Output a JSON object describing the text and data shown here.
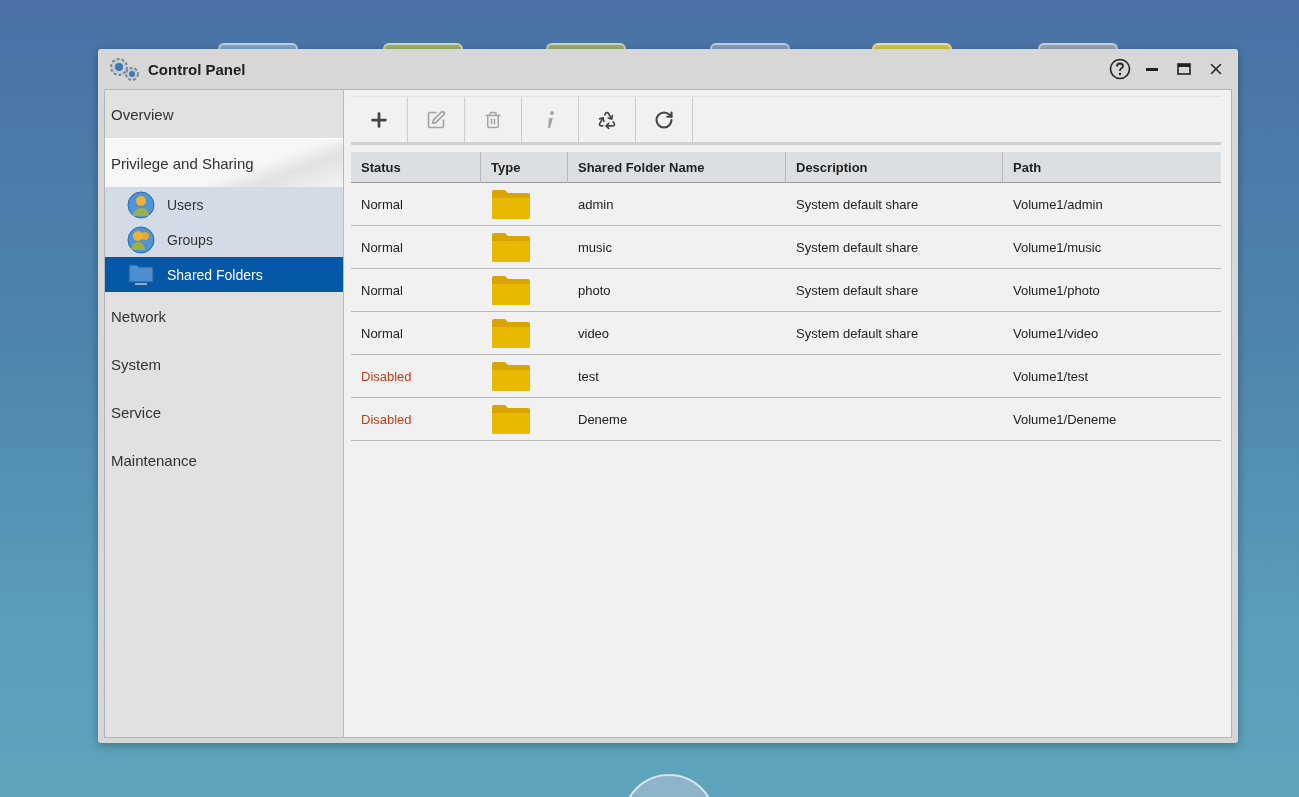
{
  "window": {
    "title": "Control Panel"
  },
  "sidebar": {
    "items": [
      {
        "label": "Overview",
        "expanded": false
      },
      {
        "label": "Privilege and Sharing",
        "expanded": true,
        "children": [
          {
            "label": "Users",
            "kind": "user",
            "selected": false
          },
          {
            "label": "Groups",
            "kind": "group",
            "selected": false
          },
          {
            "label": "Shared Folders",
            "kind": "folder",
            "selected": true
          }
        ]
      },
      {
        "label": "Network",
        "expanded": false
      },
      {
        "label": "System",
        "expanded": false
      },
      {
        "label": "Service",
        "expanded": false
      },
      {
        "label": "Maintenance",
        "expanded": false
      }
    ]
  },
  "toolbar": [
    {
      "kind": "add",
      "disabled": false
    },
    {
      "kind": "edit",
      "disabled": true
    },
    {
      "kind": "delete",
      "disabled": true
    },
    {
      "kind": "info",
      "disabled": true
    },
    {
      "kind": "recycle",
      "disabled": false
    },
    {
      "kind": "refresh",
      "disabled": false
    }
  ],
  "table": {
    "columns": [
      "Status",
      "Type",
      "Shared Folder Name",
      "Description",
      "Path"
    ],
    "rows": [
      {
        "status": "Normal",
        "disabled": false,
        "name": "admin",
        "description": "System default share",
        "path": "Volume1/admin"
      },
      {
        "status": "Normal",
        "disabled": false,
        "name": "music",
        "description": "System default share",
        "path": "Volume1/music"
      },
      {
        "status": "Normal",
        "disabled": false,
        "name": "photo",
        "description": "System default share",
        "path": "Volume1/photo"
      },
      {
        "status": "Normal",
        "disabled": false,
        "name": "video",
        "description": "System default share",
        "path": "Volume1/video"
      },
      {
        "status": "Disabled",
        "disabled": true,
        "name": "test",
        "path": "Volume1/test"
      },
      {
        "status": "Disabled",
        "disabled": true,
        "name": "Deneme",
        "path": "Volume1/Deneme"
      }
    ]
  }
}
